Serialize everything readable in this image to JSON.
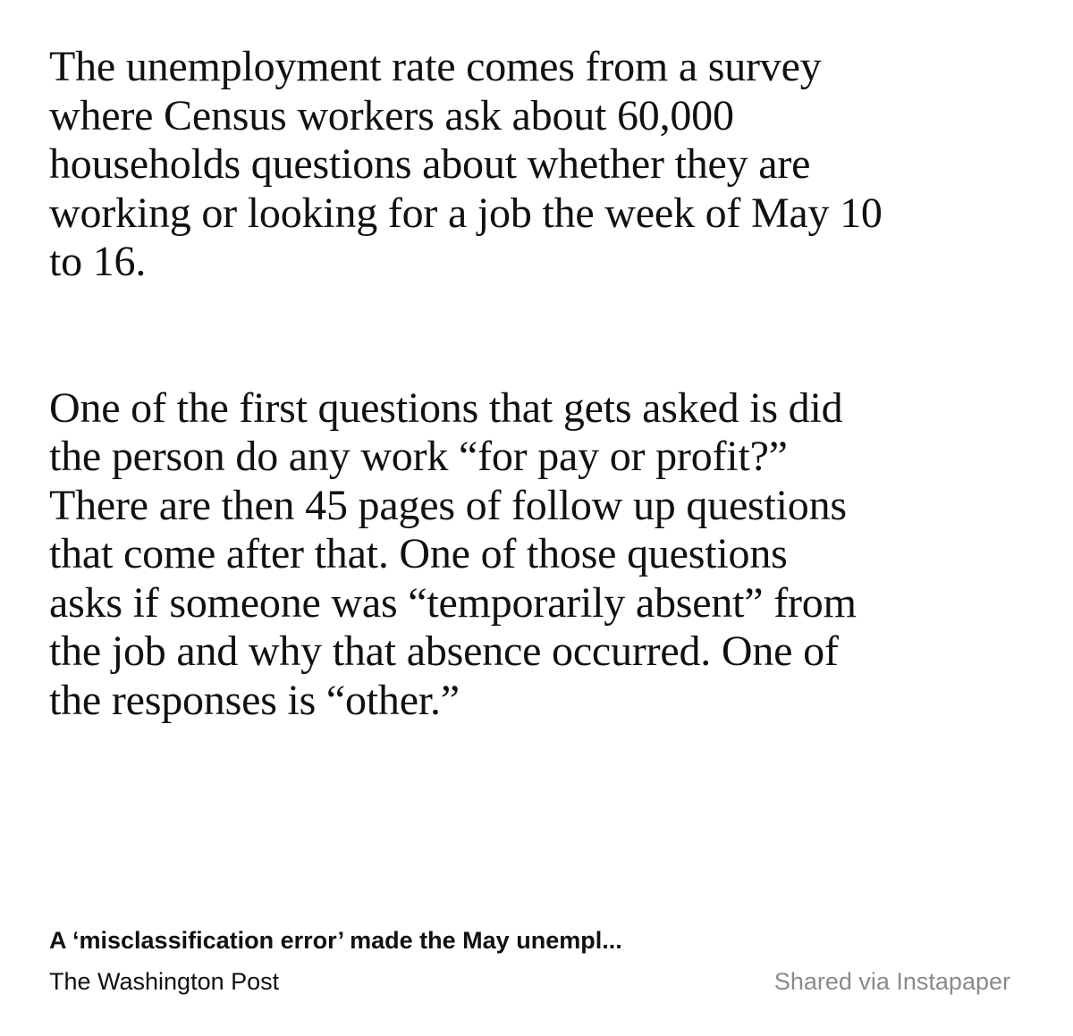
{
  "article": {
    "paragraphs": [
      {
        "lines": [
          "The unemployment rate comes from a survey",
          "where Census workers ask about 60,000",
          "households questions about whether they are",
          "working or looking for a job the week of May 10",
          "to 16."
        ]
      },
      {
        "lines": [
          "One of the first questions that gets asked is did",
          "the person do any work “for pay or profit?”",
          "There are then 45 pages of follow up questions",
          "that come after that. One of those questions",
          "asks if someone was “temporarily absent” from",
          "the job and why that absence occurred. One of",
          "the responses is “other.”"
        ]
      }
    ]
  },
  "footer": {
    "article_title": "A ‘misclassification error’ made the May unempl...",
    "source": "The Washington Post",
    "shared_via": "Shared via Instapaper"
  }
}
